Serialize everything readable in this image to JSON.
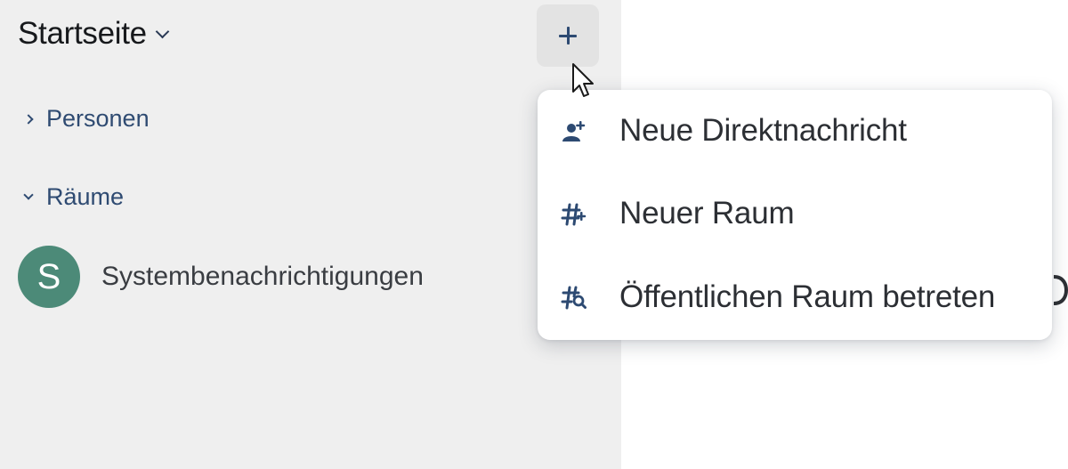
{
  "sidebar": {
    "home_title": "Startseite",
    "add_button_label": "+",
    "sections": [
      {
        "label": "Personen",
        "expanded": false
      },
      {
        "label": "Räume",
        "expanded": true
      }
    ],
    "rooms": [
      {
        "avatar_letter": "S",
        "name": "Systembenachrichtigungen",
        "avatar_color": "#4c8a78"
      }
    ]
  },
  "add_menu": {
    "items": [
      {
        "icon": "add-person-icon",
        "label": "Neue Direktnachricht"
      },
      {
        "icon": "hash-add-icon",
        "label": "Neuer Raum"
      },
      {
        "icon": "hash-search-icon",
        "label": "Öffentlichen Raum betreten"
      }
    ]
  },
  "colors": {
    "sidebar_bg": "#efefef",
    "accent": "#2f4b72",
    "avatar": "#4c8a78",
    "menu_bg": "#ffffff"
  }
}
